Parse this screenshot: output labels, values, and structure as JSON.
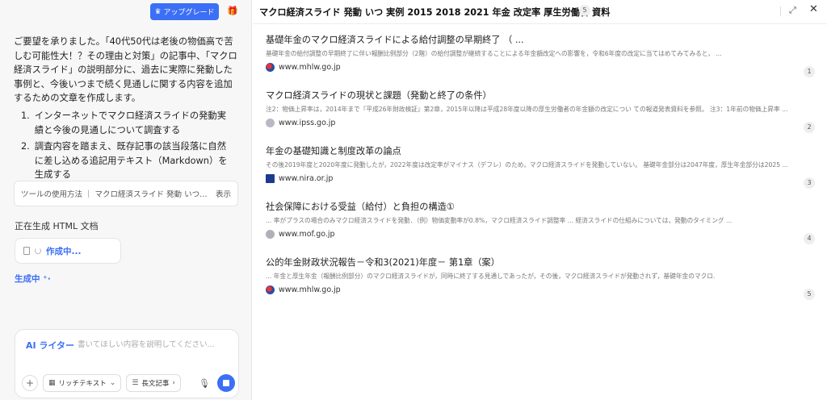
{
  "chat": {
    "upgrade_label": "アップグレード",
    "intro": "ご要望を承りました。「40代50代は老後の物価高で苦しむ可能性大！？その理由と対策」の記事中、「マクロ経済スライド」の説明部分に、過去に実際に発動した事例と、今後いつまで続く見通しに関する内容を追加するための文章を作成します。",
    "steps": [
      {
        "num": "1.",
        "text": "インターネットでマクロ経済スライドの発動実績と今後の見通しについて調査する"
      },
      {
        "num": "2.",
        "text": "調査内容を踏まえ、既存記事の該当段落に自然に差し込める追記用テキスト（Markdown）を生成する"
      }
    ],
    "tool_usage": "ツールの使用方法 ｜ マクロ経済スライド 発動 いつ 実...",
    "tool_show": "表示",
    "generating_doc_label": "正在生成 HTML 文档",
    "creating_label": "作成中...",
    "generating_label": "生成中"
  },
  "composer": {
    "ai_label": "AI ライター",
    "placeholder": "書いてほしい内容を説明してください...",
    "richtext_label": "リッチテキスト",
    "longform_label": "長文記事"
  },
  "panel": {
    "title": "マクロ経済スライド 発動 いつ 実例 2015 2018 2021 年金 改定率 厚生労働省 資料",
    "count": "5"
  },
  "results": [
    {
      "title": "基礎年金のマクロ経済スライドによる給付調整の早期終了 （ ...",
      "snippet": "基礎年金の給付調整の早期終了に伴い報酬比例部分（2階）の給付調整が継続することによる年金額改定への影響を，令和6年度の改定に当てはめてみてみると， ...",
      "domain": "www.mhlw.go.jp",
      "favicon": "mhlw",
      "index": "1"
    },
    {
      "title": "マクロ経済スライドの現状と課題（発動と終了の条件）",
      "snippet": "注2：物価上昇率は，2014年まで『平成26年財政検証』第2章，2015年以降は平成28年度以降の厚生労働者の年金額の改定につい ての報道発表資料を参照。 注3：1年前の物価上昇率 ...",
      "domain": "www.ipss.go.jp",
      "favicon": "ipss",
      "index": "2"
    },
    {
      "title": "年金の基礎知識と制度改革の論点",
      "snippet": "その後2019年度と2020年度に発動したが，2022年度は改定率がマイナス（デフレ）のため，マクロ経済スライドを発動していない。 基礎年金部分は2047年度，厚生年金部分は2025 ...",
      "domain": "www.nira.or.jp",
      "favicon": "nira",
      "index": "3"
    },
    {
      "title": "社会保障における受益（給付）と負担の構造①",
      "snippet": "... 率がプラスの場合のみマクロ経済スライドを発動．（例）物価変動率が0.8%，マクロ経済スライド調整率 ... 経済スライドの仕組みについては，発動のタイミング ...",
      "domain": "www.mof.go.jp",
      "favicon": "mof",
      "index": "4"
    },
    {
      "title": "公的年金財政状況報告－令和3(2021)年度－ 第1章（案）",
      "snippet": "... 年金と厚生年金（報酬比例部分）のマクロ経済スライドが，同時に終了する見通しであったが，その後，マクロ経済スライドが発動されず，基礎年金のマクロ.",
      "domain": "www.mhlw.go.jp",
      "favicon": "mhlw",
      "index": "5"
    }
  ]
}
